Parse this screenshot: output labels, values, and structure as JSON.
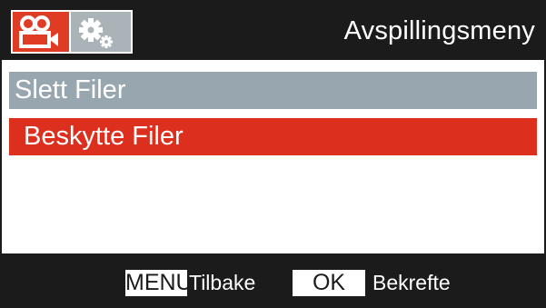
{
  "header": {
    "tabs": [
      {
        "name": "playback",
        "icon": "video-camera-icon",
        "active": true
      },
      {
        "name": "settings",
        "icon": "gears-icon",
        "active": false
      }
    ],
    "title": "Avspillingsmeny"
  },
  "menu": {
    "items": [
      {
        "label": "Slett Filer",
        "state": "normal"
      },
      {
        "label": "Beskytte Filer",
        "state": "selected"
      }
    ]
  },
  "footer": {
    "menu_key": "MENU",
    "menu_action": "Tilbake",
    "ok_key": "OK",
    "ok_action": "Bekrefte"
  },
  "colors": {
    "background": "#ffffff",
    "bar": "#1b1b1b",
    "accent_red": "#dd2f1e",
    "item_grey": "#97a6af",
    "tab_grey": "#a9b3b8"
  }
}
